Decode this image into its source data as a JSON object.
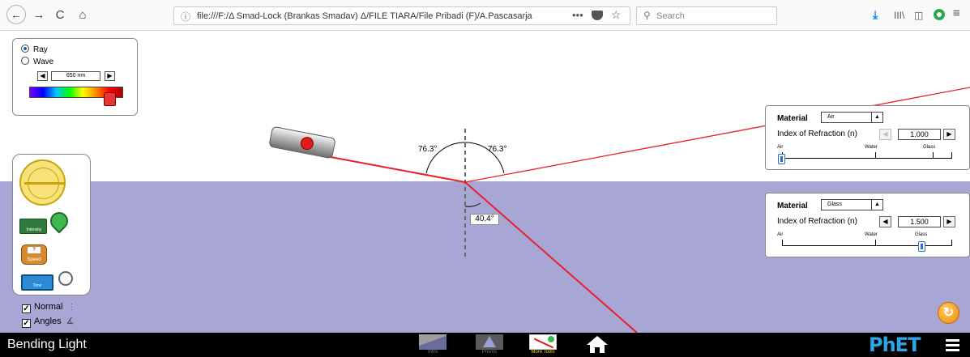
{
  "browser": {
    "back_glyph": "←",
    "forward_glyph": "→",
    "reload_glyph": "C",
    "home_glyph": "⌂",
    "info_glyph": "ⓘ",
    "url": "file:///F:/Δ Smad-Lock (Brankas Smadav) Δ/FILE TIARA/File Pribadi (F)/A.Pascasarja",
    "more_glyph": "•••",
    "bookmark_glyph": "☆",
    "search_glyph": "⚲",
    "search_placeholder": "Search",
    "download_glyph": "⤓",
    "library_glyph": "III\\",
    "sidebar_glyph": "◫",
    "menu_glyph": "≡"
  },
  "light_panel": {
    "ray_label": "Ray",
    "wave_label": "Wave",
    "selected": "Ray",
    "wavelength": "650 nm",
    "left_glyph": "◀",
    "right_glyph": "▶"
  },
  "tools": {
    "intensity_label": "Intensity",
    "speed_value": "?",
    "speed_label": "Speed",
    "time_label": "Time"
  },
  "checks": {
    "normal_label": "Normal",
    "angles_label": "Angles",
    "normal_checked": true,
    "angles_checked": true,
    "check_glyph": "✓",
    "normal_glyph": "⋮",
    "angles_glyph": "∡"
  },
  "angles": {
    "incident": "76.3°",
    "reflected": "76.3°",
    "refracted": "40.4°"
  },
  "top_medium": {
    "material_label": "Material",
    "material": "Air",
    "ior_label": "Index of Refraction (n)",
    "ior_value": "1.000",
    "ior_fraction": 0.0,
    "tick_air": "Air",
    "tick_water": "Water",
    "tick_glass": "Glass",
    "dec_glyph": "◀",
    "inc_glyph": "▶",
    "dropdown_glyph": "▲"
  },
  "bottom_medium": {
    "material_label": "Material",
    "material": "Glass",
    "ior_label": "Index of Refraction (n)",
    "ior_value": "1.500",
    "ior_fraction": 0.83,
    "tick_air": "Air",
    "tick_water": "Water",
    "tick_glass": "Glass",
    "dec_glyph": "◀",
    "inc_glyph": "▶",
    "dropdown_glyph": "▲"
  },
  "reset_glyph": "↻",
  "navbar": {
    "title": "Bending Light",
    "tab_intro": "Intro",
    "tab_prisms": "Prisms",
    "tab_more_tools": "More Tools",
    "active_tab": "More Tools",
    "logo": "PhET"
  },
  "colors": {
    "ray": "#e8202a",
    "water": "#a8a6d5",
    "active_tab": "#e8d91e",
    "logo": "#2ea6e6"
  }
}
